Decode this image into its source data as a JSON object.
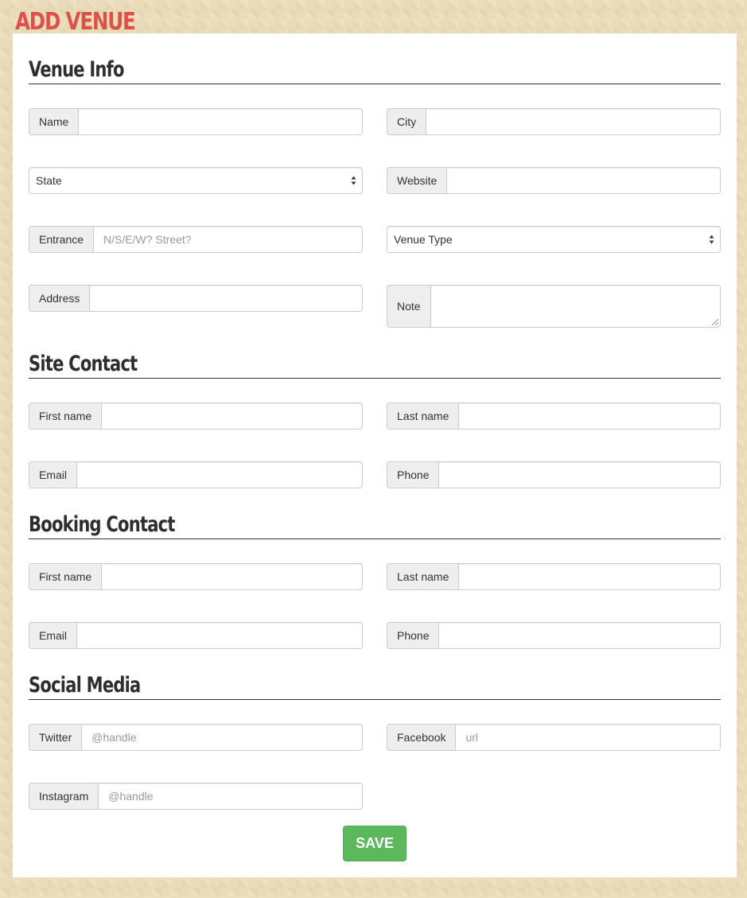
{
  "page": {
    "title": "ADD VENUE"
  },
  "venue_info": {
    "heading": "Venue Info",
    "name": {
      "label": "Name",
      "value": ""
    },
    "city": {
      "label": "City",
      "value": ""
    },
    "state": {
      "selected": "State"
    },
    "website": {
      "label": "Website",
      "value": ""
    },
    "entrance": {
      "label": "Entrance",
      "value": "",
      "placeholder": "N/S/E/W? Street?"
    },
    "venue_type": {
      "selected": "Venue Type"
    },
    "address": {
      "label": "Address",
      "value": ""
    },
    "note": {
      "label": "Note",
      "value": ""
    }
  },
  "site_contact": {
    "heading": "Site Contact",
    "first_name": {
      "label": "First name",
      "value": ""
    },
    "last_name": {
      "label": "Last name",
      "value": ""
    },
    "email": {
      "label": "Email",
      "value": ""
    },
    "phone": {
      "label": "Phone",
      "value": ""
    }
  },
  "booking_contact": {
    "heading": "Booking Contact",
    "first_name": {
      "label": "First name",
      "value": ""
    },
    "last_name": {
      "label": "Last name",
      "value": ""
    },
    "email": {
      "label": "Email",
      "value": ""
    },
    "phone": {
      "label": "Phone",
      "value": ""
    }
  },
  "social_media": {
    "heading": "Social Media",
    "twitter": {
      "label": "Twitter",
      "value": "",
      "placeholder": "@handle"
    },
    "facebook": {
      "label": "Facebook",
      "value": "",
      "placeholder": "url"
    },
    "instagram": {
      "label": "Instagram",
      "value": "",
      "placeholder": "@handle"
    }
  },
  "actions": {
    "save_label": "SAVE"
  },
  "colors": {
    "title": "#dc5149",
    "save_button": "#5cb85c",
    "background": "#eadcb8",
    "addon_background": "#eeeeee",
    "border": "#cccccc"
  },
  "icons": {
    "select_arrows": "updown-caret-icon",
    "resize": "resize-grip-icon"
  }
}
